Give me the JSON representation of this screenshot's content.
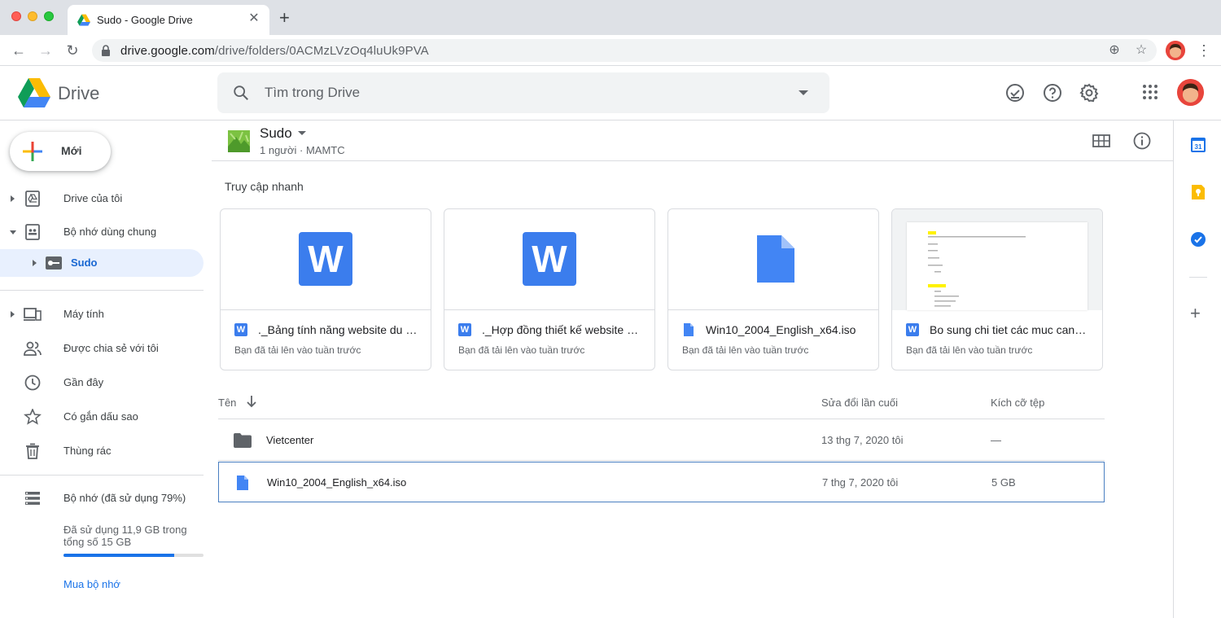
{
  "browser": {
    "tab_title": "Sudo - Google Drive",
    "url_host": "drive.google.com",
    "url_path": "/drive/folders/0ACMzLVzOq4luUk9PVA"
  },
  "header": {
    "app_name": "Drive",
    "search_placeholder": "Tìm trong Drive"
  },
  "sidebar": {
    "new_label": "Mới",
    "items": [
      {
        "label": "Drive của tôi",
        "icon": "my-drive-icon"
      },
      {
        "label": "Bộ nhớ dùng chung",
        "icon": "shared-drives-icon"
      },
      {
        "label": "Sudo",
        "icon": "shared-drive-icon"
      },
      {
        "label": "Máy tính",
        "icon": "computers-icon"
      },
      {
        "label": "Được chia sẻ với tôi",
        "icon": "shared-with-me-icon"
      },
      {
        "label": "Gần đây",
        "icon": "recent-icon"
      },
      {
        "label": "Có gắn dấu sao",
        "icon": "starred-icon"
      },
      {
        "label": "Thùng rác",
        "icon": "trash-icon"
      },
      {
        "label": "Bộ nhớ (đã sử dụng 79%)",
        "icon": "storage-icon"
      }
    ],
    "storage_text": "Đã sử dụng 11,9 GB trong tổng số 15 GB",
    "storage_used_fraction": 0.79,
    "buy_storage": "Mua bộ nhớ"
  },
  "folder": {
    "name": "Sudo",
    "meta": "1 người · MAMTC"
  },
  "quick_access": {
    "title": "Truy cập nhanh",
    "cards": [
      {
        "name": "._Bảng tính năng website du lị...",
        "subtitle": "Bạn đã tải lên vào tuần trước",
        "type": "word"
      },
      {
        "name": "._Hợp đồng thiết kế website Vi...",
        "subtitle": "Bạn đã tải lên vào tuần trước",
        "type": "word"
      },
      {
        "name": "Win10_2004_English_x64.iso",
        "subtitle": "Bạn đã tải lên vào tuần trước",
        "type": "file"
      },
      {
        "name": "Bo sung chi tiet các muc can l...",
        "subtitle": "Bạn đã tải lên vào tuần trước",
        "type": "word"
      }
    ]
  },
  "file_list": {
    "col_name": "Tên",
    "col_modified": "Sửa đổi lần cuối",
    "col_size": "Kích cỡ tệp",
    "rows": [
      {
        "name": "Vietcenter",
        "modified": "13 thg 7, 2020  tôi",
        "size": "—",
        "type": "folder"
      },
      {
        "name": "Win10_2004_English_x64.iso",
        "modified": "7 thg 7, 2020  tôi",
        "size": "5 GB",
        "type": "file"
      }
    ]
  },
  "colors": {
    "accent": "#1a73e8",
    "active_bg": "#e8f0fe",
    "word_blue": "#3b7ded"
  }
}
